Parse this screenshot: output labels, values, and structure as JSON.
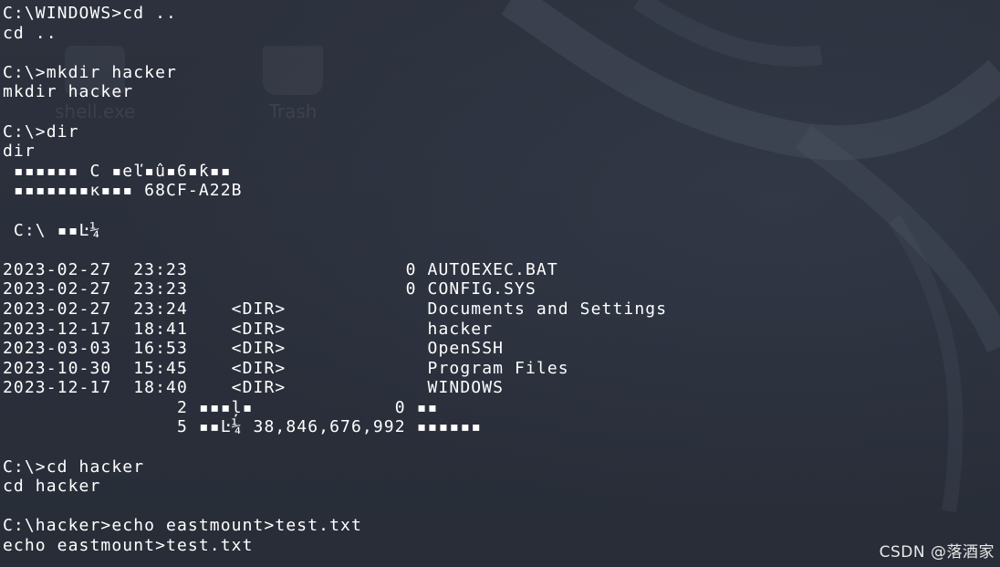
{
  "terminal": {
    "lines": [
      "C:\\WINDOWS>cd ..",
      "cd ..",
      "",
      "C:\\>mkdir hacker",
      "mkdir hacker",
      "",
      "C:\\>dir",
      "dir",
      " ▪▪▪▪▪▪ C ▪eľ▪û▪6▪ƙ▪▪",
      " ▪▪▪▪▪▪▪κ▪▪▪ 68CF-A22B",
      "",
      " C:\\ ▪▪Ŀ¼",
      "",
      "2023-02-27  23:23                    0 AUTOEXEC.BAT",
      "2023-02-27  23:23                    0 CONFIG.SYS",
      "2023-02-27  23:24    <DIR>             Documents and Settings",
      "2023-12-17  18:41    <DIR>             hacker",
      "2023-03-03  16:53    <DIR>             OpenSSH",
      "2023-10-30  15:45    <DIR>             Program Files",
      "2023-12-17  18:40    <DIR>             WINDOWS",
      "                2 ▪▪▪ļ▪             0 ▪▪",
      "                5 ▪▪Ŀ¼ 38,846,676,992 ▪▪▪▪▪▪",
      "",
      "C:\\>cd hacker",
      "cd hacker",
      "",
      "C:\\hacker>echo eastmount>test.txt",
      "echo eastmount>test.txt"
    ]
  },
  "desktop_icons": [
    {
      "label": "shell.exe",
      "icon": "executable-icon"
    },
    {
      "label": "Trash",
      "icon": "trash-icon"
    }
  ],
  "watermark": "CSDN @落酒家"
}
